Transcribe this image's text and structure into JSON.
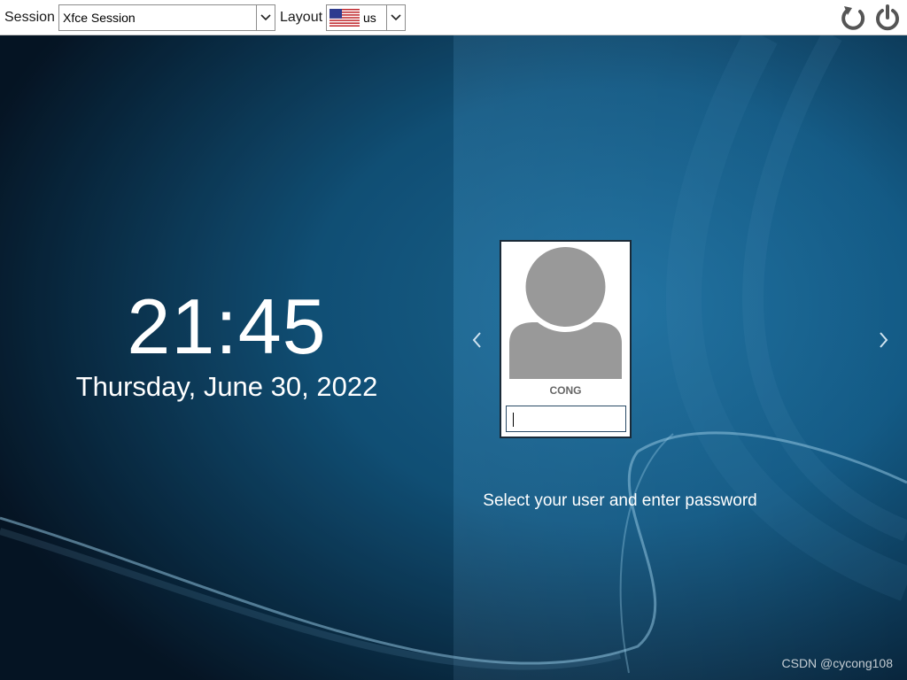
{
  "topbar": {
    "session_label": "Session",
    "session_value": "Xfce Session",
    "layout_label": "Layout",
    "layout_value": "us",
    "layout_flag": "us-flag-icon",
    "restart_icon": "restart-icon",
    "power_icon": "power-icon"
  },
  "clock": {
    "time": "21:45",
    "date": "Thursday, June 30, 2022"
  },
  "user": {
    "name": "CONG",
    "password_value": "",
    "avatar_icon": "user-avatar-icon"
  },
  "navigation": {
    "prev_icon": "chevron-left-icon",
    "next_icon": "chevron-right-icon"
  },
  "hint": "Select your user and enter password",
  "watermark": "CSDN @cycong108",
  "colors": {
    "background_dark": "#071a2b",
    "background_light": "#1a6fa0",
    "accent_line": "#7fb5d6",
    "avatar_gray": "#999999"
  }
}
